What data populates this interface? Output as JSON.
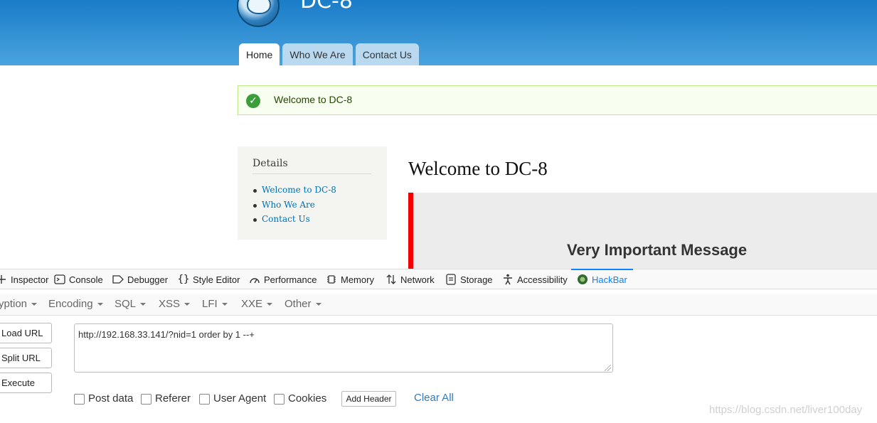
{
  "site": {
    "name": "DC-8",
    "tabs": [
      "Home",
      "Who We Are",
      "Contact Us"
    ]
  },
  "status_message": "Welcome to DC-8",
  "sidebar": {
    "title": "Details",
    "items": [
      "Welcome to DC-8",
      "Who We Are",
      "Contact Us"
    ]
  },
  "main": {
    "title": "Welcome to DC-8",
    "message_heading": "Very Important Message"
  },
  "devtools": {
    "tabs": [
      "Inspector",
      "Console",
      "Debugger",
      "Style Editor",
      "Performance",
      "Memory",
      "Network",
      "Storage",
      "Accessibility",
      "HackBar"
    ],
    "active_tab": "HackBar",
    "accent_color": "#0a84ff"
  },
  "hackbar": {
    "menu": [
      "yption",
      "Encoding",
      "SQL",
      "XSS",
      "LFI",
      "XXE",
      "Other"
    ],
    "buttons": [
      "Load URL",
      "Split URL",
      "Execute"
    ],
    "url": "http://192.168.33.141/?nid=1 order by 1 --+",
    "options": [
      "Post data",
      "Referer",
      "User Agent",
      "Cookies"
    ],
    "add_header": "Add Header",
    "clear_all": "Clear All"
  },
  "watermark": "https://blog.csdn.net/liver100day"
}
